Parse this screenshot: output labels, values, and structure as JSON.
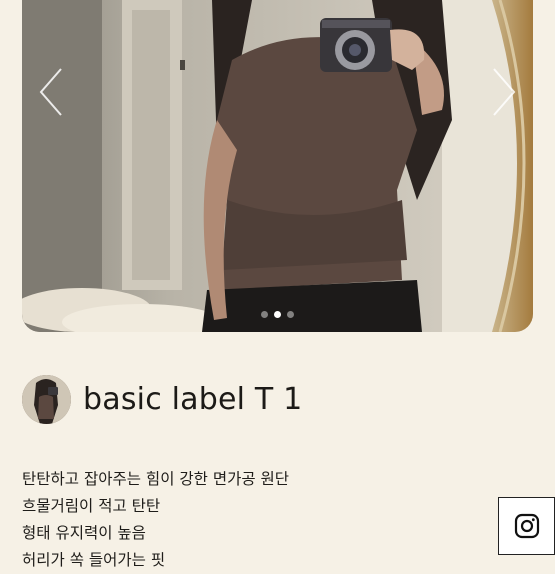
{
  "carousel": {
    "prev_icon": "chevron-left-icon",
    "next_icon": "chevron-right-icon",
    "slide_count": 3,
    "active_slide": 1
  },
  "seller": {
    "name": "basic label T 1"
  },
  "description": {
    "lines": [
      "탄탄하고 잡아주는 힘이 강한 면가공 원단",
      "흐물거림이 적고 탄탄",
      "형태 유지력이 높음",
      "허리가 쏙 들어가는 핏"
    ]
  },
  "social": {
    "icon": "instagram-icon"
  },
  "colors": {
    "background": "#f6f1e6",
    "text": "#1c1a17"
  }
}
